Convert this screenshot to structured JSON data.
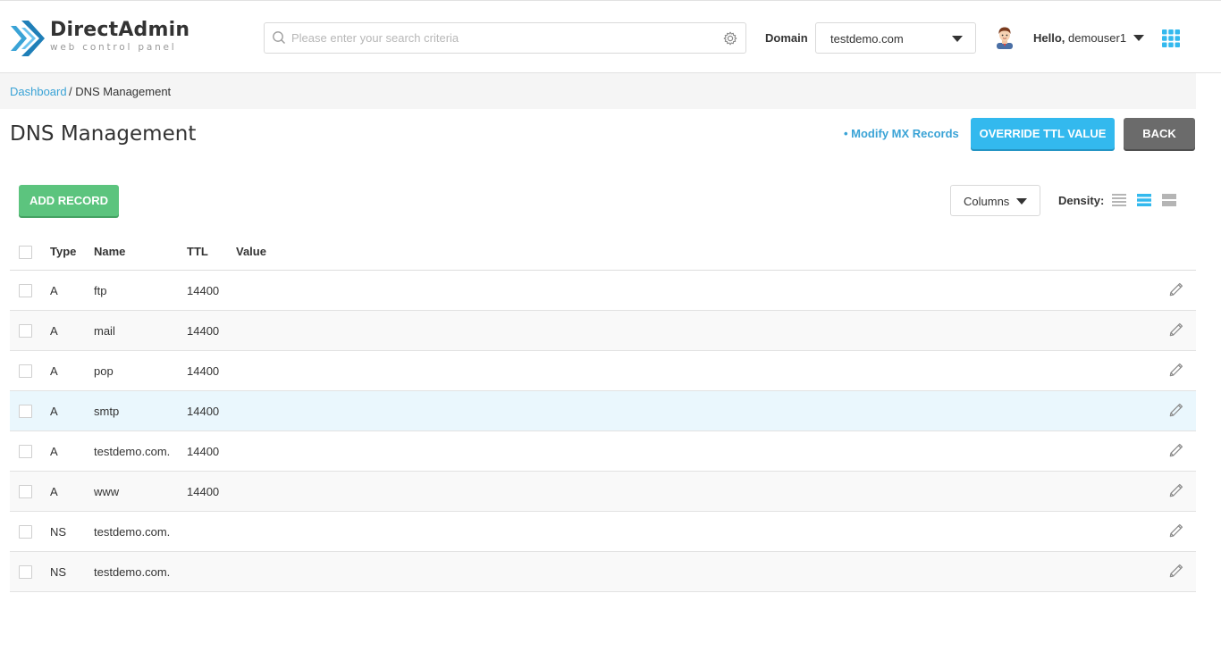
{
  "header": {
    "logo_title": "DirectAdmin",
    "logo_subtitle": "web control panel",
    "search_placeholder": "Please enter your search criteria",
    "domain_label": "Domain",
    "domain_value": "testdemo.com",
    "greeting": "Hello,",
    "username": "demouser1"
  },
  "breadcrumb": {
    "link": "Dashboard",
    "current": "/ DNS Management"
  },
  "page": {
    "title": "DNS Management",
    "mx_link": "• Modify MX Records",
    "override_button": "OVERRIDE TTL VALUE",
    "back_button": "BACK",
    "add_button": "ADD RECORD",
    "columns_button": "Columns",
    "density_label": "Density:"
  },
  "colors": {
    "accent": "#33b9ee",
    "link": "#3aa3d6",
    "add": "#5cc47e",
    "back": "#6b6b6b",
    "highlight_row": "#eaf7fd"
  },
  "table": {
    "headers": {
      "type": "Type",
      "name": "Name",
      "ttl": "TTL",
      "value": "Value"
    },
    "rows": [
      {
        "type": "A",
        "name": "ftp",
        "ttl": "14400",
        "value": ""
      },
      {
        "type": "A",
        "name": "mail",
        "ttl": "14400",
        "value": ""
      },
      {
        "type": "A",
        "name": "pop",
        "ttl": "14400",
        "value": ""
      },
      {
        "type": "A",
        "name": "smtp",
        "ttl": "14400",
        "value": ""
      },
      {
        "type": "A",
        "name": "testdemo.com.",
        "ttl": "14400",
        "value": ""
      },
      {
        "type": "A",
        "name": "www",
        "ttl": "14400",
        "value": ""
      },
      {
        "type": "NS",
        "name": "testdemo.com.",
        "ttl": "",
        "value": ""
      },
      {
        "type": "NS",
        "name": "testdemo.com.",
        "ttl": "",
        "value": ""
      }
    ]
  }
}
